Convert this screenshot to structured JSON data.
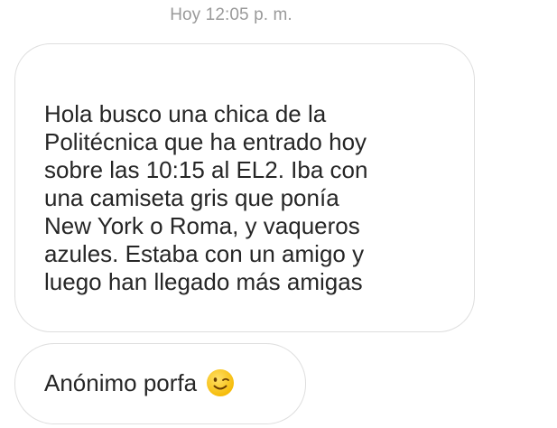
{
  "timestamp": "Hoy 12:05 p. m.",
  "messages": [
    {
      "text": "Hola busco una chica de la\nPolitécnica que ha entrado hoy\nsobre las 10:15 al EL2. Iba con\nuna camiseta gris que ponía\nNew York o Roma, y vaqueros\nazules. Estaba con un amigo y\nluego han llegado más amigas"
    },
    {
      "text": "Anónimo porfa",
      "emoji": "winking-face-emoji-icon"
    }
  ]
}
